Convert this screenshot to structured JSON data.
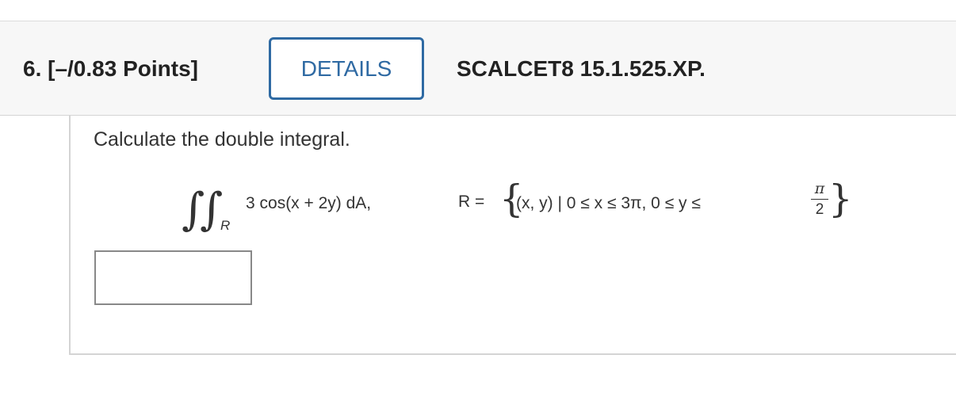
{
  "question": {
    "number_points": "6.  [–/0.83 Points]",
    "details_label": "DETAILS",
    "source": "SCALCET8 15.1.525.XP."
  },
  "problem": {
    "prompt": "Calculate the double integral.",
    "integral_symbol": "∫∫",
    "region_subscript": "R",
    "integrand": "3 cos(x + 2y) dA,",
    "region_lhs": "R =",
    "set_body": "(x, y) | 0 ≤ x ≤ 3π, 0 ≤ y ≤",
    "frac_numerator": "π",
    "frac_denominator": "2",
    "brace_open": "{",
    "brace_close": "}"
  },
  "answer": {
    "value": ""
  }
}
